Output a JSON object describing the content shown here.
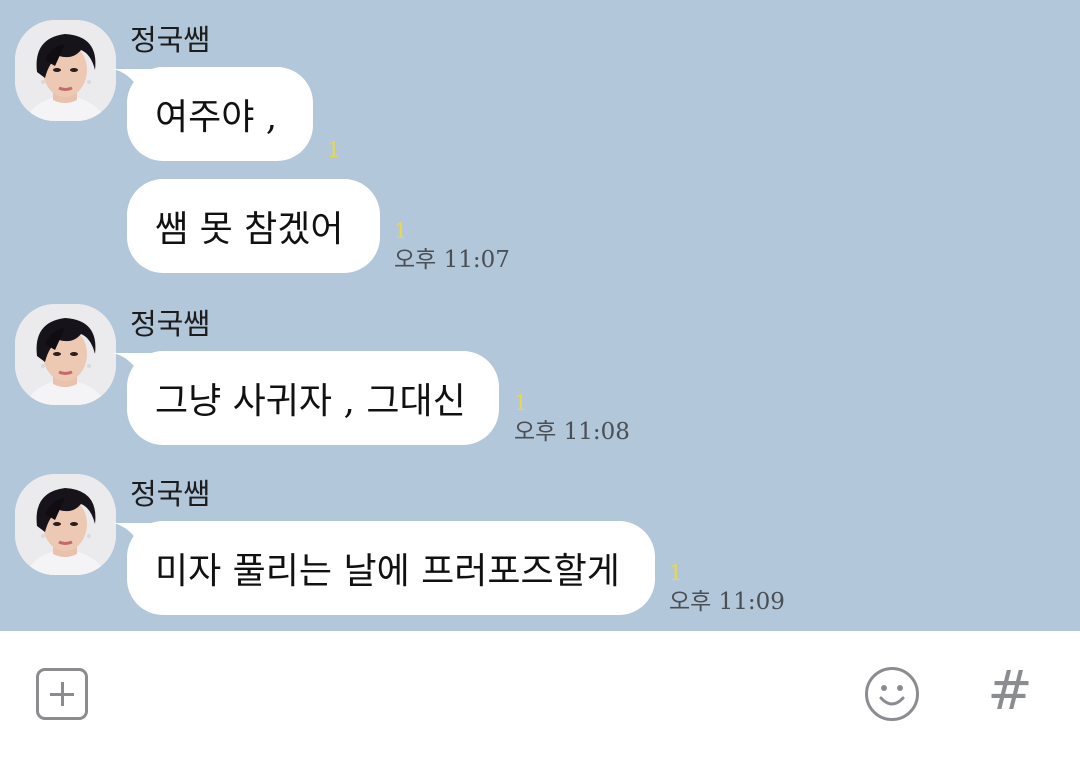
{
  "chat": {
    "messages": [
      {
        "sender": "정국쌤",
        "bubbles": [
          {
            "text": "여주야 ,",
            "read_count": "1",
            "time": ""
          },
          {
            "text": "쌤 못 참겠어",
            "read_count": "1",
            "time": "오후 11:07"
          }
        ]
      },
      {
        "sender": "정국쌤",
        "bubbles": [
          {
            "text": "그냥 사귀자 , 그대신",
            "read_count": "1",
            "time": "오후 11:08"
          }
        ]
      },
      {
        "sender": "정국쌤",
        "bubbles": [
          {
            "text": "미자 풀리는 날에 프러포즈할게",
            "read_count": "1",
            "time": "오후 11:09"
          }
        ]
      }
    ]
  },
  "input_bar": {
    "icons": [
      "plus-icon",
      "emoji-icon",
      "hashtag-icon"
    ],
    "hash_glyph": "#"
  },
  "colors": {
    "chat_background": "#b2c7da",
    "bubble": "#ffffff",
    "read_count": "#e8d84a",
    "icon": "#8a8c90"
  }
}
